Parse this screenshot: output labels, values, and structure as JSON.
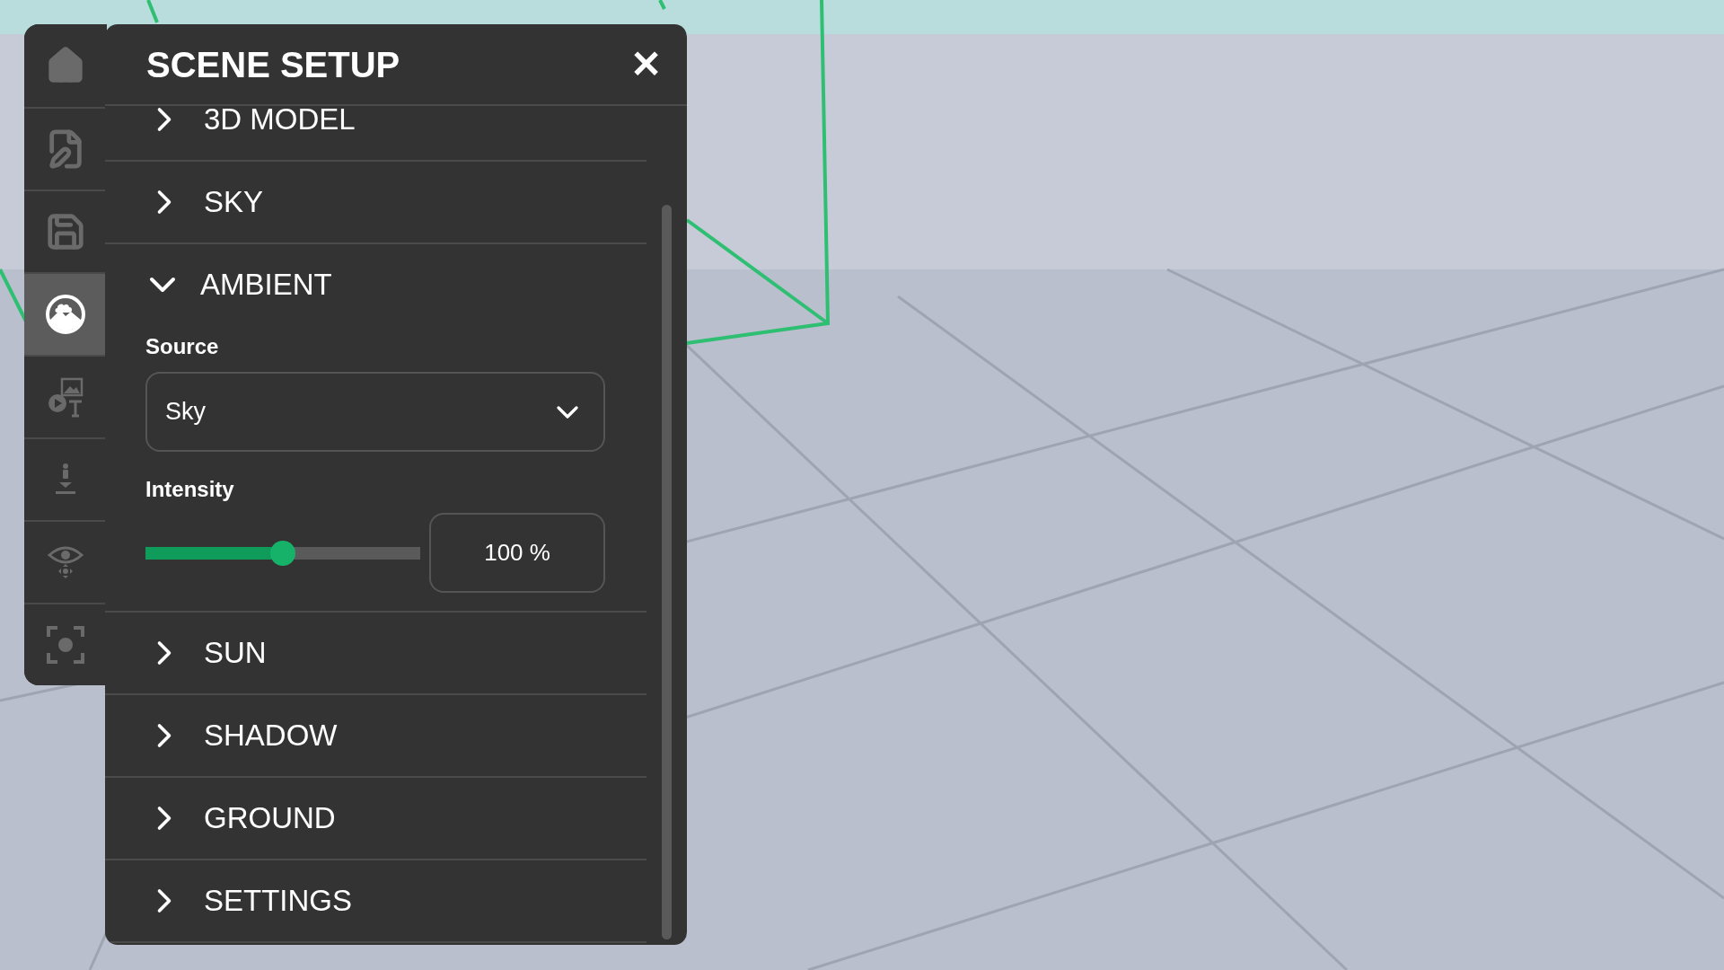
{
  "toolbar": {
    "items": [
      {
        "kind": "home",
        "selected": false
      },
      {
        "kind": "edit",
        "selected": false
      },
      {
        "kind": "save",
        "selected": false
      },
      {
        "kind": "scene",
        "selected": true
      },
      {
        "kind": "media",
        "selected": false
      },
      {
        "kind": "place",
        "selected": false
      },
      {
        "kind": "view",
        "selected": false
      },
      {
        "kind": "focus",
        "selected": false
      }
    ]
  },
  "panel": {
    "title": "SCENE SETUP",
    "close": "✕",
    "sections": [
      {
        "label": "3D MODEL",
        "expanded": false
      },
      {
        "label": "SKY",
        "expanded": false
      },
      {
        "label": "AMBIENT",
        "expanded": true,
        "source": {
          "label": "Source",
          "value": "Sky"
        },
        "intensity": {
          "label": "Intensity",
          "level": 0.5,
          "value": "100 %"
        }
      },
      {
        "label": "SUN",
        "expanded": false
      },
      {
        "label": "SHADOW",
        "expanded": false
      },
      {
        "label": "GROUND",
        "expanded": false
      },
      {
        "label": "SETTINGS",
        "expanded": false
      }
    ]
  }
}
